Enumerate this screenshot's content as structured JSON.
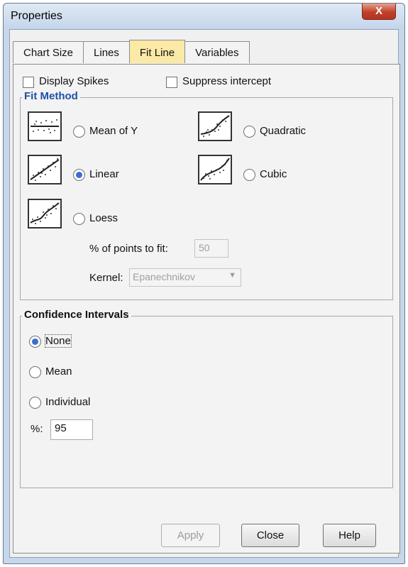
{
  "window": {
    "title": "Properties",
    "close_glyph": "X"
  },
  "tabs": [
    {
      "label": "Chart Size",
      "active": false
    },
    {
      "label": "Lines",
      "active": false
    },
    {
      "label": "Fit Line",
      "active": true
    },
    {
      "label": "Variables",
      "active": false
    }
  ],
  "options": {
    "display_spikes": {
      "label": "Display Spikes",
      "checked": false
    },
    "suppress_intercept": {
      "label": "Suppress intercept",
      "checked": false
    }
  },
  "fit_method": {
    "title": "Fit Method",
    "selected": "Linear",
    "methods": [
      "Mean of Y",
      "Quadratic",
      "Linear",
      "Cubic",
      "Loess"
    ],
    "points_label": "% of points to fit:",
    "points_value": "50",
    "kernel_label": "Kernel:",
    "kernel_value": "Epanechnikov"
  },
  "confidence": {
    "title": "Confidence Intervals",
    "selected": "None",
    "options": [
      "None",
      "Mean",
      "Individual"
    ],
    "percent_label": "%:",
    "percent_value": "95"
  },
  "buttons": {
    "apply": "Apply",
    "close": "Close",
    "help": "Help"
  },
  "colors": {
    "accent": "#1f4fa8",
    "active_tab": "#fbe9a6",
    "close_button": "#c0402a"
  }
}
